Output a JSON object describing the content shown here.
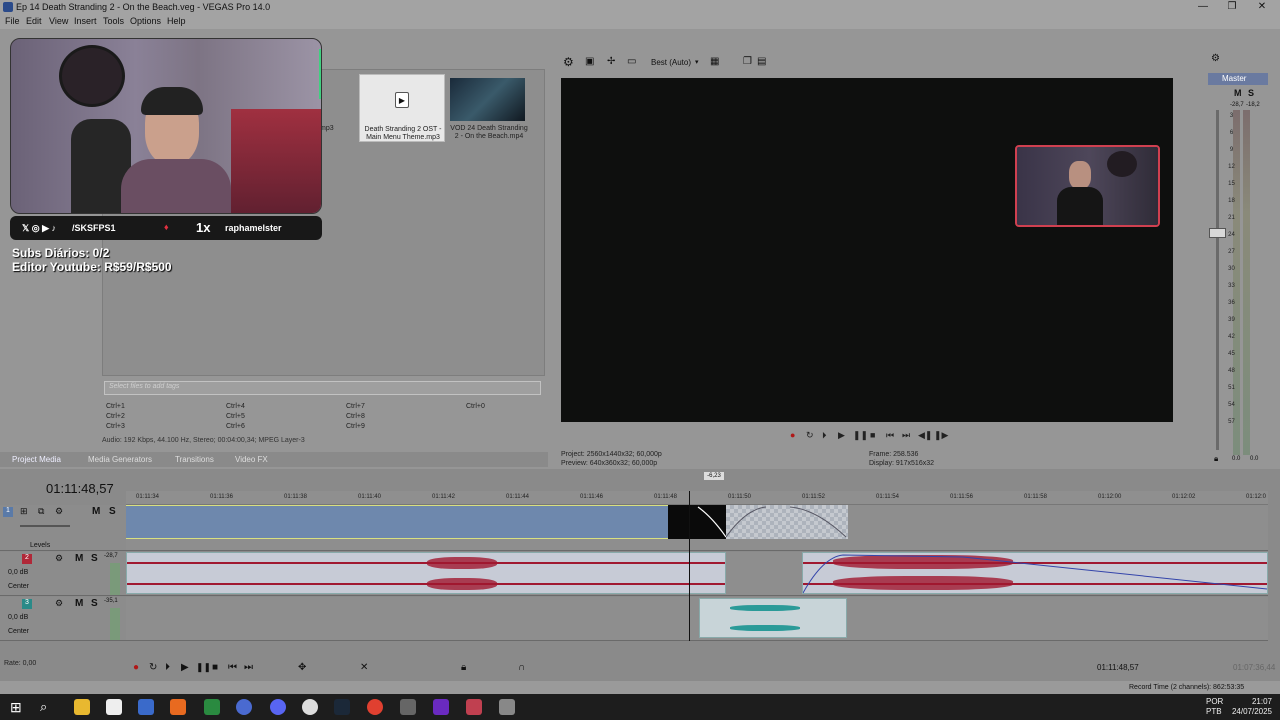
{
  "window": {
    "title": "Ep 14 Death Stranding 2 - On the Beach.veg - VEGAS Pro 14.0",
    "minimize": "—",
    "maximize": "❐",
    "close": "✕"
  },
  "menu": [
    "File",
    "Edit",
    "View",
    "Insert",
    "Tools",
    "Options",
    "Help"
  ],
  "media": {
    "left_partial_label": "mp3",
    "items": [
      {
        "label_line1": "Death Stranding 2 OST -",
        "label_line2": "Main Menu Theme.mp3"
      },
      {
        "label_line1": "VOD 24 Death Stranding",
        "label_line2": "2 - On the Beach.mp4"
      }
    ],
    "search_placeholder": "Select files to add tags",
    "shortcuts": [
      "Ctrl+1",
      "Ctrl+2",
      "Ctrl+3",
      "Ctrl+4",
      "Ctrl+5",
      "Ctrl+6",
      "Ctrl+7",
      "Ctrl+8",
      "Ctrl+9",
      "Ctrl+0"
    ],
    "audio_info": "Audio: 192 Kbps, 44.100 Hz, Stereo; 00:04:00,34; MPEG Layer-3",
    "tabs": [
      "Project Media",
      "Media Generators",
      "Transitions",
      "Video FX"
    ]
  },
  "overlay": {
    "social_handle": "/SKSFPS1",
    "multiplier": "1x",
    "username": "raphamelster",
    "subs_line": "Subs Diários: 0/2",
    "editor_line": "Editor Youtube: R$59/R$500"
  },
  "preview": {
    "quality": "Best (Auto)",
    "project_label": "Project:",
    "project_value": "2560x1440x32; 60,000p",
    "preview_label": "Preview:",
    "preview_value": "640x360x32; 60,000p",
    "frame_label": "Frame:",
    "frame_value": "258.536",
    "display_label": "Display:",
    "display_value": "917x516x32"
  },
  "mixer": {
    "title": "Master",
    "mute": "M",
    "solo": "S",
    "peak_left": "-28,7",
    "peak_right": "-18,2",
    "marks": [
      "3",
      "6",
      "9",
      "12",
      "15",
      "18",
      "21",
      "24",
      "27",
      "30",
      "33",
      "36",
      "39",
      "42",
      "45",
      "48",
      "51",
      "54",
      "57"
    ],
    "bottom_left": "0.0",
    "bottom_right": "0.0"
  },
  "timeline": {
    "timecode": "01:11:48,57",
    "ruler_marks": [
      "01:11:34",
      "01:11:36",
      "01:11:38",
      "01:11:40",
      "01:11:42",
      "01:11:44",
      "01:11:46",
      "01:11:48",
      "01:11:50",
      "01:11:52",
      "01:11:54",
      "01:11:56",
      "01:11:58",
      "01:12:00",
      "01:12:02",
      "01:12:0"
    ],
    "playhead_badge": "-6,23",
    "video_track": {
      "number": "1",
      "mute": "M",
      "solo": "S",
      "levels": "Levels"
    },
    "audio_track_1": {
      "number": "2",
      "mute": "M",
      "solo": "S",
      "db": "0,0 dB",
      "pan": "Center",
      "peak": "-28,7"
    },
    "audio_track_2": {
      "number": "3",
      "mute": "M",
      "solo": "S",
      "db": "0,0 dB",
      "pan": "Center",
      "peak": "-35,1"
    },
    "rate": "Rate: 0,00",
    "cursor_time": "01:11:48,57",
    "end_time": "01:07:36,44",
    "record_time": "Record Time (2 channels): 862:53:35"
  },
  "taskbar": {
    "lang1": "POR",
    "lang2": "PTB",
    "time": "21:07",
    "date": "24/07/2025"
  },
  "colors": {
    "video_clip": "#6e88ad",
    "audio_wave": "#a01830",
    "preview_border": "#d04050"
  }
}
